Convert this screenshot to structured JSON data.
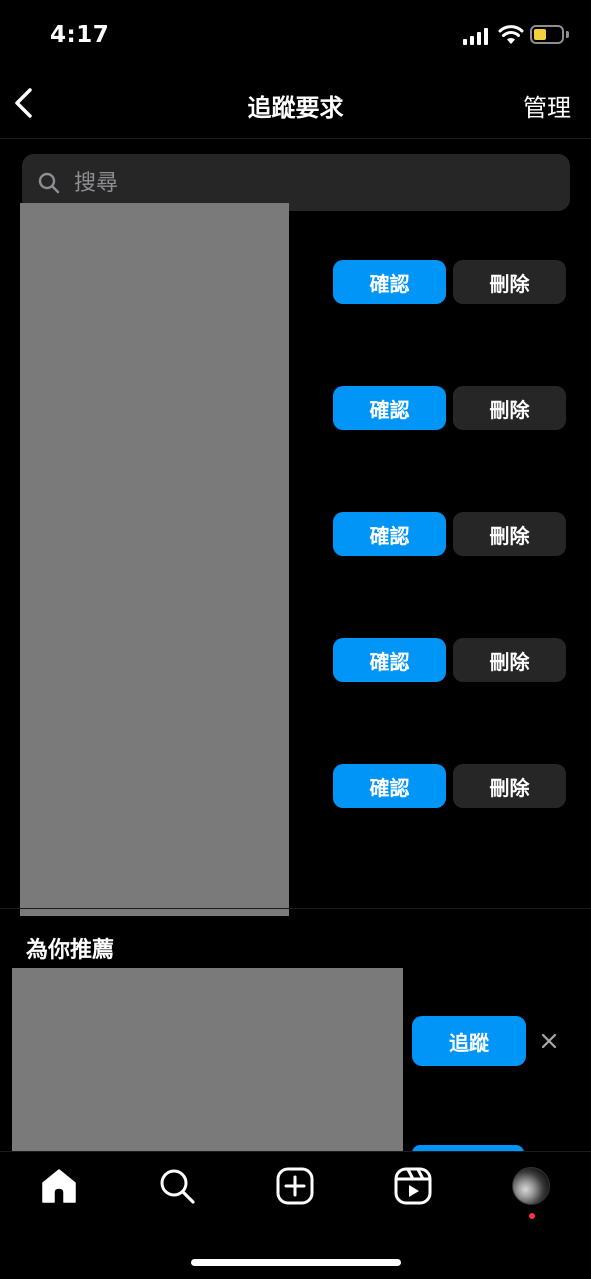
{
  "status_bar": {
    "time": "4:17",
    "battery_level": 0.4
  },
  "header": {
    "title": "追蹤要求",
    "manage_label": "管理"
  },
  "search": {
    "placeholder": "搜尋"
  },
  "requests": [
    {
      "confirm_label": "確認",
      "delete_label": "刪除"
    },
    {
      "confirm_label": "確認",
      "delete_label": "刪除"
    },
    {
      "confirm_label": "確認",
      "delete_label": "刪除"
    },
    {
      "confirm_label": "確認",
      "delete_label": "刪除"
    },
    {
      "confirm_label": "確認",
      "delete_label": "刪除"
    }
  ],
  "suggested": {
    "title": "為你推薦",
    "items": [
      {
        "follow_label": "追蹤"
      }
    ]
  },
  "tabbar": {
    "icons": [
      "home-icon",
      "search-icon",
      "create-icon",
      "reels-icon",
      "profile-avatar"
    ]
  },
  "colors": {
    "accent": "#0095f6",
    "secondary_button": "#262626",
    "background": "#000000",
    "notification_dot": "#ff3040"
  }
}
